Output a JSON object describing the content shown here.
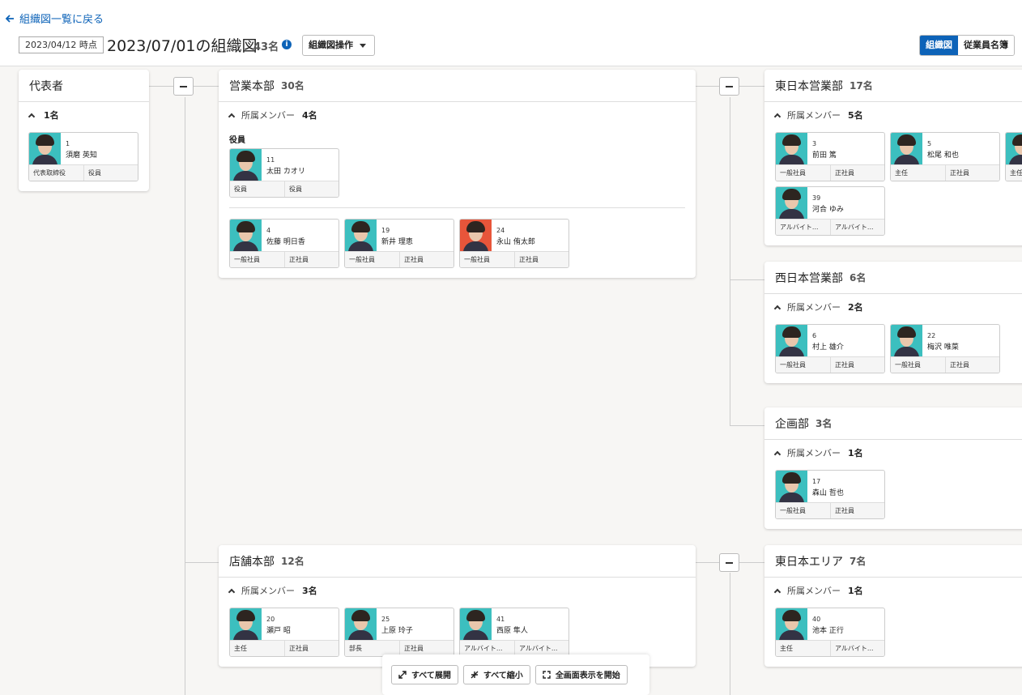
{
  "header": {
    "back_link": "組織図一覧に戻る",
    "as_of": "2023/04/12 時点",
    "title": "2023/07/01の組織図",
    "count": "43名",
    "operations_button": "組織図操作",
    "view_org": "組織図",
    "view_directory": "従業員名簿"
  },
  "labels": {
    "members": "所属メンバー",
    "executives": "役員"
  },
  "depts": {
    "rep": {
      "name": "代表者",
      "member_count": "1名",
      "employees": [
        {
          "no": "1",
          "name": "須磨 英知",
          "role": "代表取締役",
          "type": "役員"
        }
      ]
    },
    "sales_hq": {
      "name": "営業本部",
      "count": "30名",
      "member_count": "4名",
      "executives": [
        {
          "no": "11",
          "name": "太田 カオリ",
          "role": "役員",
          "type": "役員"
        }
      ],
      "employees": [
        {
          "no": "4",
          "name": "佐藤 明日香",
          "role": "一般社員",
          "type": "正社員"
        },
        {
          "no": "19",
          "name": "新井 理恵",
          "role": "一般社員",
          "type": "正社員"
        },
        {
          "no": "24",
          "name": "永山 侑太郎",
          "role": "一般社員",
          "type": "正社員"
        }
      ]
    },
    "east_sales": {
      "name": "東日本営業部",
      "count": "17名",
      "member_count": "5名",
      "employees": [
        {
          "no": "3",
          "name": "前田 篤",
          "role": "一般社員",
          "type": "正社員"
        },
        {
          "no": "5",
          "name": "松尾 和也",
          "role": "主任",
          "type": "正社員"
        },
        {
          "no": "",
          "name": "",
          "role": "主任",
          "type": ""
        },
        {
          "no": "39",
          "name": "河合 ゆみ",
          "role": "アルバイト...",
          "type": "アルバイト..."
        }
      ]
    },
    "west_sales": {
      "name": "西日本営業部",
      "count": "6名",
      "member_count": "2名",
      "employees": [
        {
          "no": "6",
          "name": "村上 雄介",
          "role": "一般社員",
          "type": "正社員"
        },
        {
          "no": "22",
          "name": "梅沢 唯菜",
          "role": "一般社員",
          "type": "正社員"
        }
      ]
    },
    "planning": {
      "name": "企画部",
      "count": "3名",
      "member_count": "1名",
      "employees": [
        {
          "no": "17",
          "name": "森山 哲也",
          "role": "一般社員",
          "type": "正社員"
        }
      ]
    },
    "store_hq": {
      "name": "店舗本部",
      "count": "12名",
      "member_count": "3名",
      "employees": [
        {
          "no": "20",
          "name": "瀬戸 昭",
          "role": "主任",
          "type": "正社員"
        },
        {
          "no": "25",
          "name": "上原 玲子",
          "role": "部長",
          "type": "正社員"
        },
        {
          "no": "41",
          "name": "西原 隼人",
          "role": "アルバイト...",
          "type": "アルバイト..."
        }
      ]
    },
    "east_area": {
      "name": "東日本エリア",
      "count": "7名",
      "member_count": "1名",
      "employees": [
        {
          "no": "40",
          "name": "池本 正行",
          "role": "主任",
          "type": "アルバイト..."
        }
      ]
    }
  },
  "toolbar": {
    "expand_all": "すべて展開",
    "collapse_all": "すべて縮小",
    "fullscreen": "全画面表示を開始"
  },
  "colors": {
    "accent": "#0d63b8",
    "photo_bg": "#3cbfbf"
  }
}
